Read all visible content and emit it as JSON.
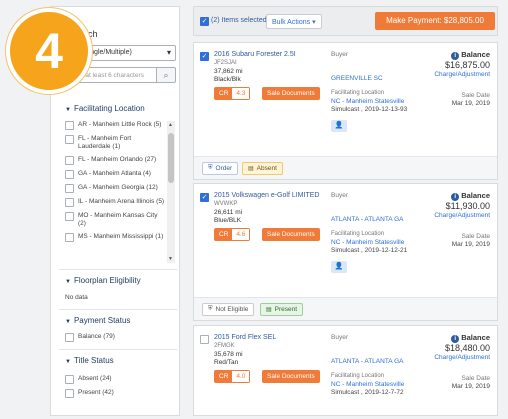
{
  "badge": {
    "number": "4"
  },
  "filters": {
    "search_label": "Search",
    "select_value": "VIN (Single/Multiple)",
    "search_placeholder": "Enter at least 6 characters",
    "facilitating_location": {
      "title": "Facilitating Location",
      "items": [
        {
          "label": "AR - Manheim Little Rock (5)"
        },
        {
          "label": "FL - Manheim Fort Lauderdale (1)"
        },
        {
          "label": "FL - Manheim Orlando (27)"
        },
        {
          "label": "GA - Manheim Atlanta (4)"
        },
        {
          "label": "GA - Manheim Georgia (12)"
        },
        {
          "label": "IL - Manheim Arena Illinois (5)"
        },
        {
          "label": "MO - Manheim Kansas City (2)"
        },
        {
          "label": "MS - Manheim Mississippi (1)"
        }
      ]
    },
    "floorplan": {
      "title": "Floorplan Eligibility",
      "value": "No data"
    },
    "payment_status": {
      "title": "Payment Status",
      "items": [
        {
          "label": "Balance (79)"
        }
      ]
    },
    "title_status": {
      "title": "Title Status",
      "items": [
        {
          "label": "Absent (24)"
        },
        {
          "label": "Present (42)"
        }
      ]
    }
  },
  "toolbar": {
    "selected_text": "(2) Items selected",
    "bulk_actions": "Bulk Actions ▾",
    "make_payment": "Make Payment: $28,805.00"
  },
  "vehicles": [
    {
      "title": "2016 Subaru Forester 2.5I",
      "vin": "JF2SJAI",
      "miles": "37,862 mi",
      "color": "Black/Blk",
      "cr_label": "CR",
      "cr_grade": "4.3",
      "sale_docs": "Sale Documents",
      "buyer_label": "Buyer",
      "buyer_city": "GREENVILLE SC",
      "fac_label": "Facilitating Location",
      "fac_name": "NC - Manheim Statesville",
      "fac_detail": "Simulcast , 2019-12-13-93",
      "balance_label": "Balance",
      "balance_amount": "$16,875.00",
      "charge_link": "Charge/Adjustment",
      "sale_date_label": "Sale Date",
      "sale_date": "Mar 19, 2019",
      "checked": true,
      "footer": [
        {
          "label": "Order",
          "icon": "shield"
        },
        {
          "label": "Absent",
          "icon": "doc"
        }
      ]
    },
    {
      "title": "2015 Volkswagen e-Golf LIMITED",
      "vin": "WVWKP",
      "miles": "26,611 mi",
      "color": "Blue/BLK",
      "cr_label": "CR",
      "cr_grade": "4.6",
      "sale_docs": "Sale Documents",
      "buyer_label": "Buyer",
      "buyer_city": "ATLANTA - ATLANTA GA",
      "fac_label": "Facilitating Location",
      "fac_name": "NC - Manheim Statesville",
      "fac_detail": "Simulcast , 2019-12-12-21",
      "balance_label": "Balance",
      "balance_amount": "$11,930.00",
      "charge_link": "Charge/Adjustment",
      "sale_date_label": "Sale Date",
      "sale_date": "Mar 19, 2019",
      "checked": true,
      "footer": [
        {
          "label": "Not Eligible",
          "icon": "shield"
        },
        {
          "label": "Present",
          "icon": "doc"
        }
      ]
    },
    {
      "title": "2015 Ford Flex SEL",
      "vin": "2FMGK",
      "miles": "35,678 mi",
      "color": "Red/Tan",
      "cr_label": "CR",
      "cr_grade": "4.0",
      "sale_docs": "Sale Documents",
      "buyer_label": "Buyer",
      "buyer_city": "ATLANTA - ATLANTA GA",
      "fac_label": "Facilitating Location",
      "fac_name": "NC - Manheim Statesville",
      "fac_detail": "Simulcast , 2019-12-7-72",
      "balance_label": "Balance",
      "balance_amount": "$18,480.00",
      "charge_link": "Charge/Adjustment",
      "sale_date_label": "Sale Date",
      "sale_date": "Mar 19, 2019",
      "checked": false
    }
  ],
  "colors": {
    "accent_orange": "#f07a38",
    "link_blue": "#2f6fd6",
    "badge": "#f6a41b"
  }
}
